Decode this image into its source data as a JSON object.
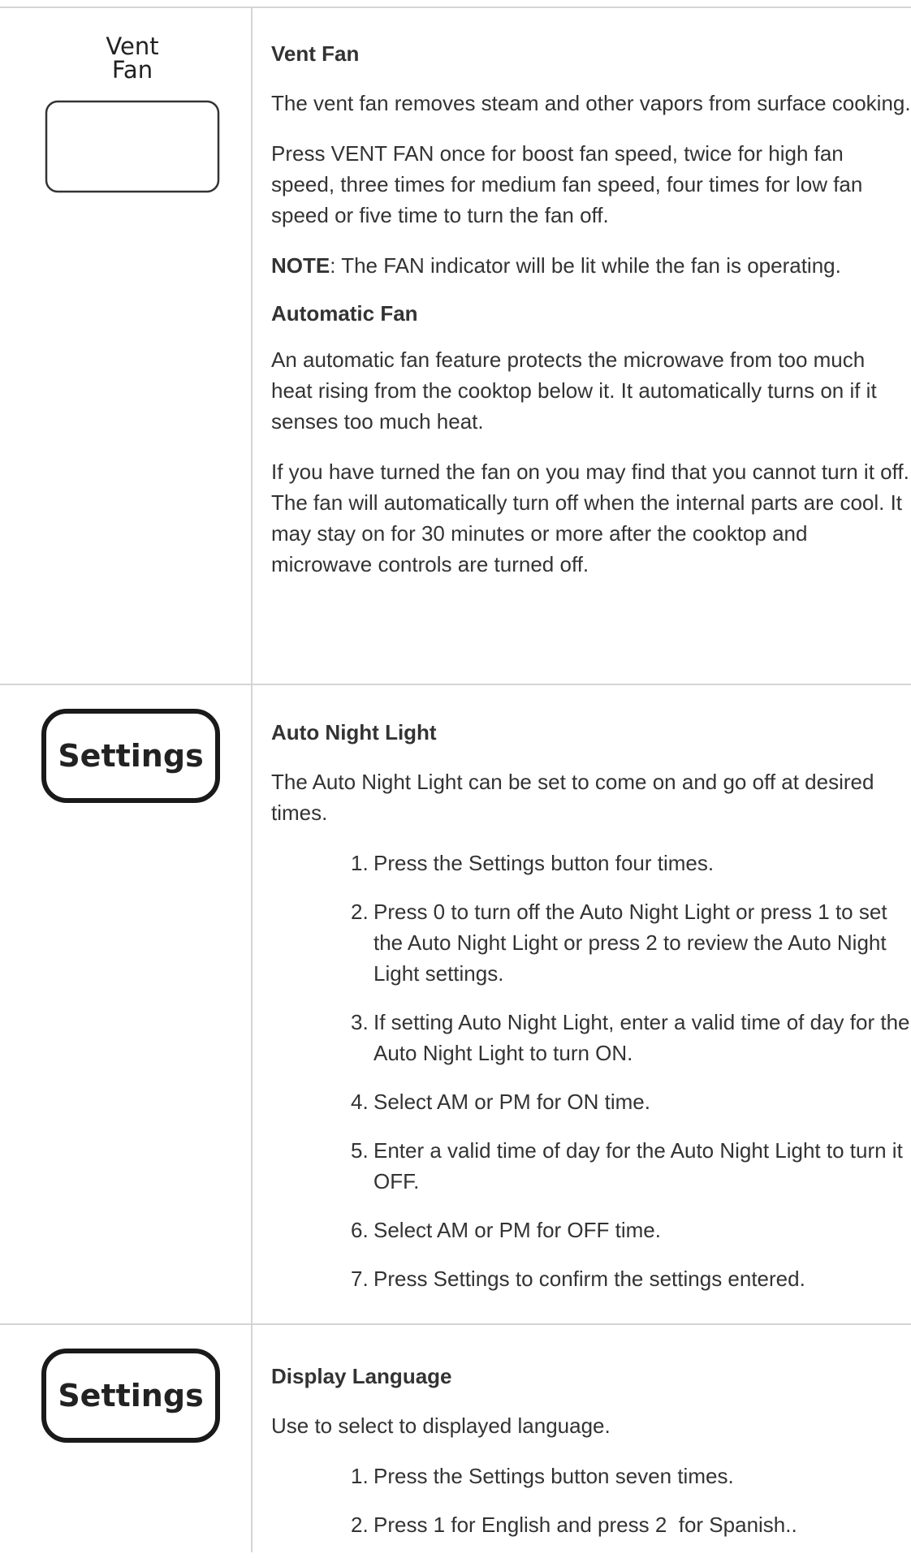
{
  "vent_fan": {
    "icon_label_line1": "Vent",
    "icon_label_line2": "Fan",
    "title": "Vent Fan",
    "p1": "The vent fan removes steam and other vapors from surface cooking.",
    "p2": "Press VENT FAN once for boost fan speed, twice for high fan speed, three times for medium fan speed, four times for low fan speed or five time to turn the fan off.",
    "note_label": "NOTE",
    "note_text": ": The FAN indicator will be lit while the fan is operating.",
    "auto_title": "Automatic Fan",
    "p3": "An automatic fan feature protects the microwave from too much heat rising from the cooktop below it. It automatically turns on if it senses too much heat.",
    "p4": "If you have turned the fan on you may find that you cannot turn it off. The fan will automatically turn off when the internal parts are cool. It may stay on for 30 minutes or more after the cooktop and microwave controls are turned off."
  },
  "night_light": {
    "icon_label": "Settings",
    "title": "Auto Night Light",
    "intro": "The Auto Night Light can be set to come on and go off at desired times.",
    "steps": [
      "Press the Settings button four times.",
      "Press 0 to turn off the Auto Night Light or press 1 to set the Auto Night Light or press 2 to review the Auto Night Light settings.",
      "If setting Auto Night Light, enter a valid time of day for the Auto Night Light to turn ON.",
      "Select AM or PM for ON time.",
      "Enter a valid time of day for the Auto Night Light to turn it OFF.",
      "Select AM or PM for OFF time.",
      "Press Settings to confirm the settings entered."
    ]
  },
  "language": {
    "icon_label": "Settings",
    "title": "Display Language",
    "intro": "Use to select to displayed language.",
    "steps": [
      "Press the Settings button seven times.",
      "Press 1 for English and press 2  for Spanish.."
    ]
  },
  "step_numbers": [
    "1.",
    "2.",
    "3.",
    "4.",
    "5.",
    "6.",
    "7."
  ]
}
